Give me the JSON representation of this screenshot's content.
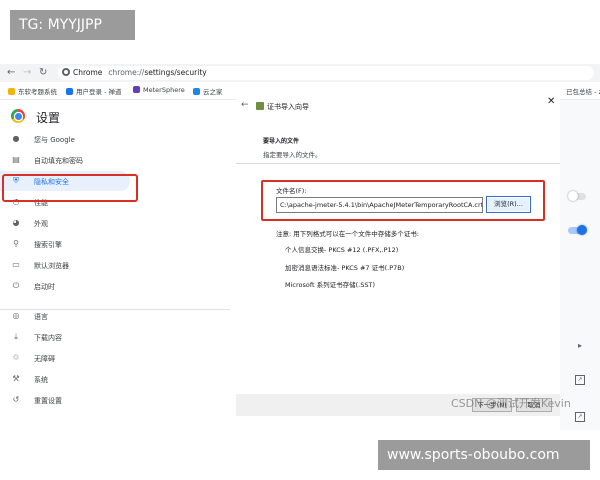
{
  "tag_top": "TG: MYYJJPP",
  "browser": {
    "back_icon": "arrow-left-icon",
    "forward_icon": "arrow-right-icon",
    "reload_icon": "reload-icon",
    "chrome_chip": "Chrome",
    "url_prefix": "chrome://",
    "url_path": "settings/security",
    "bookmarks": [
      {
        "label": "东软考题系统",
        "color": "#f4b400"
      },
      {
        "label": "用户登录 - 禅道",
        "color": "#1a73e8"
      },
      {
        "label": "MeterSphere",
        "color": "#673ab7"
      },
      {
        "label": "云之家",
        "color": "#1e88e5"
      }
    ],
    "bookmark_right": "已包总结 - zjy"
  },
  "settings": {
    "title": "设置",
    "sidebar": [
      {
        "label": "您与 Google",
        "icon": "person-icon",
        "glyph": "●"
      },
      {
        "label": "自动填充和密码",
        "icon": "clipboard-icon",
        "glyph": "▤"
      },
      {
        "label": "隐私和安全",
        "icon": "shield-icon",
        "glyph": "⛨",
        "active": true
      },
      {
        "label": "性能",
        "icon": "speedometer-icon",
        "glyph": "◔"
      },
      {
        "label": "外观",
        "icon": "palette-icon",
        "glyph": "◕"
      },
      {
        "label": "搜索引擎",
        "icon": "search-icon",
        "glyph": "⚲"
      },
      {
        "label": "默认浏览器",
        "icon": "browser-icon",
        "glyph": "▭"
      },
      {
        "label": "启动时",
        "icon": "power-icon",
        "glyph": "⏻"
      },
      {
        "label": "语言",
        "icon": "globe-icon",
        "glyph": "◎"
      },
      {
        "label": "下载内容",
        "icon": "download-icon",
        "glyph": "⤓"
      },
      {
        "label": "无障碍",
        "icon": "accessibility-icon",
        "glyph": "♲"
      },
      {
        "label": "系统",
        "icon": "wrench-icon",
        "glyph": "⚒"
      },
      {
        "label": "重置设置",
        "icon": "history-icon",
        "glyph": "↺"
      }
    ]
  },
  "dialog": {
    "title": "证书导入向导",
    "close": "✕",
    "heading": "要导入的文件",
    "subheading": "指定要导入的文件。",
    "file_label": "文件名(F):",
    "file_value": "C:\\apache-jmeter-5.4.1\\bin\\ApacheJMeterTemporaryRootCA.crt",
    "browse_button": "浏览(R)...",
    "note": "注意: 用下列格式可以在一个文件中存储多个证书:",
    "formats": [
      "个人信息交换- PKCS #12 (.PFX,.P12)",
      "加密消息语法标准- PKCS #7 证书(.P7B)",
      "Microsoft 系列证书存储(.SST)"
    ],
    "next_button": "下一步(N)",
    "cancel_button": "取消"
  },
  "watermark": "CSDN @测试开发Kevin",
  "tag_bottom": "www.sports-oboubo.com",
  "colors": {
    "accent": "#1a73e8",
    "highlight_red": "#d93025",
    "active_bg": "#e8f0fe"
  }
}
